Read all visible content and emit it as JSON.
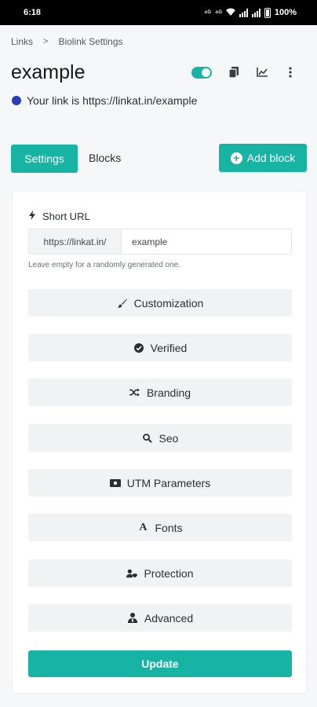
{
  "status_bar": {
    "time": "6:18",
    "battery": "100%"
  },
  "breadcrumb": {
    "items": [
      "Links",
      "Biolink Settings"
    ],
    "separator": ">"
  },
  "header": {
    "title": "example",
    "link_text": "Your link is https://linkat.in/example",
    "toggle_on": true
  },
  "tabs": {
    "settings": "Settings",
    "blocks": "Blocks",
    "add_block": "Add block"
  },
  "short_url": {
    "label": "Short URL",
    "prefix": "https://linkat.in/",
    "value": "example",
    "help": "Leave empty for a randomly generated one."
  },
  "sections": [
    {
      "label": "Customization",
      "icon": "paintbrush-icon"
    },
    {
      "label": "Verified",
      "icon": "check-circle-icon"
    },
    {
      "label": "Branding",
      "icon": "random-icon"
    },
    {
      "label": "Seo",
      "icon": "search-icon"
    },
    {
      "label": "UTM Parameters",
      "icon": "money-bill-icon"
    },
    {
      "label": "Fonts",
      "icon": "font-icon"
    },
    {
      "label": "Protection",
      "icon": "user-shield-icon"
    },
    {
      "label": "Advanced",
      "icon": "user-tie-icon"
    }
  ],
  "update_label": "Update",
  "colors": {
    "accent": "#17b3a3",
    "dot": "#2a3fb6"
  }
}
